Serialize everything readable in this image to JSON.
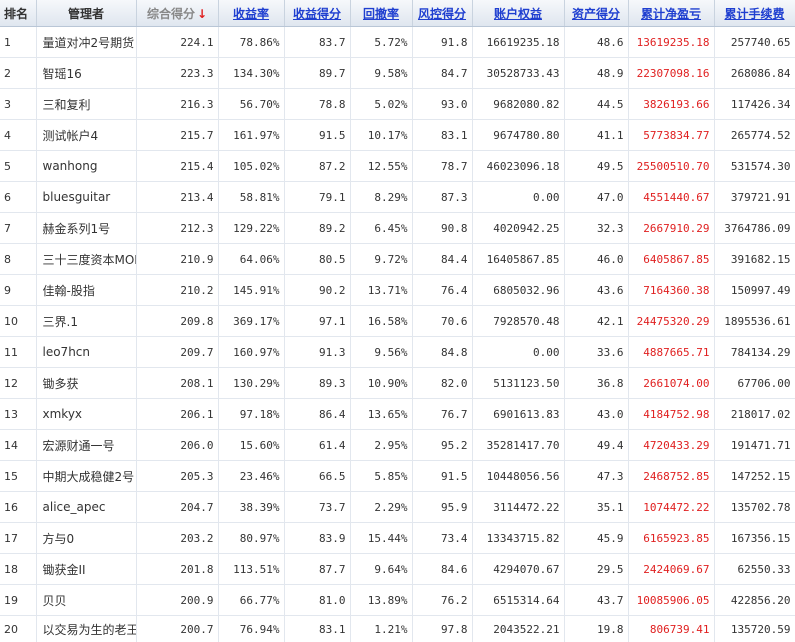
{
  "colors": {
    "link": "#1f3fd0",
    "loss_profit": "#e02020",
    "sorted_header": "#888888"
  },
  "headers": {
    "rank": "排名",
    "manager": "管理者",
    "score": "综合得分",
    "return_rate": "收益率",
    "return_score": "收益得分",
    "drawdown": "回撤率",
    "risk_score": "风控得分",
    "equity": "账户权益",
    "asset_score": "资产得分",
    "cum_profit": "累计净盈亏",
    "cum_fee": "累计手续费"
  },
  "sort_icon": "down-arrow-icon",
  "rows": [
    {
      "rank": "1",
      "name": "量道对冲2号期货",
      "score": "224.1",
      "ret": "78.86%",
      "ret_score": "83.7",
      "dd": "5.72%",
      "risk": "91.8",
      "equity": "16619235.18",
      "asset": "48.6",
      "profit": "13619235.18",
      "fee": "257740.65"
    },
    {
      "rank": "2",
      "name": "智瑶16",
      "score": "223.3",
      "ret": "134.30%",
      "ret_score": "89.7",
      "dd": "9.58%",
      "risk": "84.7",
      "equity": "30528733.43",
      "asset": "48.9",
      "profit": "22307098.16",
      "fee": "268086.84"
    },
    {
      "rank": "3",
      "name": "三和复利",
      "score": "216.3",
      "ret": "56.70%",
      "ret_score": "78.8",
      "dd": "5.02%",
      "risk": "93.0",
      "equity": "9682080.82",
      "asset": "44.5",
      "profit": "3826193.66",
      "fee": "117426.34"
    },
    {
      "rank": "4",
      "name": "测试帐户4",
      "score": "215.7",
      "ret": "161.97%",
      "ret_score": "91.5",
      "dd": "10.17%",
      "risk": "83.1",
      "equity": "9674780.80",
      "asset": "41.1",
      "profit": "5773834.77",
      "fee": "265774.52"
    },
    {
      "rank": "5",
      "name": "wanhong",
      "score": "215.4",
      "ret": "105.02%",
      "ret_score": "87.2",
      "dd": "12.55%",
      "risk": "78.7",
      "equity": "46023096.18",
      "asset": "49.5",
      "profit": "25500510.70",
      "fee": "531574.30"
    },
    {
      "rank": "6",
      "name": "bluesguitar",
      "score": "213.4",
      "ret": "58.81%",
      "ret_score": "79.1",
      "dd": "8.29%",
      "risk": "87.3",
      "equity": "0.00",
      "asset": "47.0",
      "profit": "4551440.67",
      "fee": "379721.91"
    },
    {
      "rank": "7",
      "name": "赫金系列1号",
      "score": "212.3",
      "ret": "129.22%",
      "ret_score": "89.2",
      "dd": "6.45%",
      "risk": "90.8",
      "equity": "4020942.25",
      "asset": "32.3",
      "profit": "2667910.29",
      "fee": "3764786.09"
    },
    {
      "rank": "8",
      "name": "三十三度资本MOM",
      "score": "210.9",
      "ret": "64.06%",
      "ret_score": "80.5",
      "dd": "9.72%",
      "risk": "84.4",
      "equity": "16405867.85",
      "asset": "46.0",
      "profit": "6405867.85",
      "fee": "391682.15"
    },
    {
      "rank": "9",
      "name": "佳翰-股指",
      "score": "210.2",
      "ret": "145.91%",
      "ret_score": "90.2",
      "dd": "13.71%",
      "risk": "76.4",
      "equity": "6805032.96",
      "asset": "43.6",
      "profit": "7164360.38",
      "fee": "150997.49"
    },
    {
      "rank": "10",
      "name": "三界.1",
      "score": "209.8",
      "ret": "369.17%",
      "ret_score": "97.1",
      "dd": "16.58%",
      "risk": "70.6",
      "equity": "7928570.48",
      "asset": "42.1",
      "profit": "24475320.29",
      "fee": "1895536.61"
    },
    {
      "rank": "11",
      "name": "leo7hcn",
      "score": "209.7",
      "ret": "160.97%",
      "ret_score": "91.3",
      "dd": "9.56%",
      "risk": "84.8",
      "equity": "0.00",
      "asset": "33.6",
      "profit": "4887665.71",
      "fee": "784134.29"
    },
    {
      "rank": "12",
      "name": "锄多获",
      "score": "208.1",
      "ret": "130.29%",
      "ret_score": "89.3",
      "dd": "10.90%",
      "risk": "82.0",
      "equity": "5131123.50",
      "asset": "36.8",
      "profit": "2661074.00",
      "fee": "67706.00"
    },
    {
      "rank": "13",
      "name": "xmkyx",
      "score": "206.1",
      "ret": "97.18%",
      "ret_score": "86.4",
      "dd": "13.65%",
      "risk": "76.7",
      "equity": "6901613.83",
      "asset": "43.0",
      "profit": "4184752.98",
      "fee": "218017.02"
    },
    {
      "rank": "14",
      "name": "宏源财通一号",
      "score": "206.0",
      "ret": "15.60%",
      "ret_score": "61.4",
      "dd": "2.95%",
      "risk": "95.2",
      "equity": "35281417.70",
      "asset": "49.4",
      "profit": "4720433.29",
      "fee": "191471.71"
    },
    {
      "rank": "15",
      "name": "中期大成稳健2号",
      "score": "205.3",
      "ret": "23.46%",
      "ret_score": "66.5",
      "dd": "5.85%",
      "risk": "91.5",
      "equity": "10448056.56",
      "asset": "47.3",
      "profit": "2468752.85",
      "fee": "147252.15"
    },
    {
      "rank": "16",
      "name": "alice_apec",
      "score": "204.7",
      "ret": "38.39%",
      "ret_score": "73.7",
      "dd": "2.29%",
      "risk": "95.9",
      "equity": "3114472.22",
      "asset": "35.1",
      "profit": "1074472.22",
      "fee": "135702.78"
    },
    {
      "rank": "17",
      "name": "方与0",
      "score": "203.2",
      "ret": "80.97%",
      "ret_score": "83.9",
      "dd": "15.44%",
      "risk": "73.4",
      "equity": "13343715.82",
      "asset": "45.9",
      "profit": "6165923.85",
      "fee": "167356.15"
    },
    {
      "rank": "18",
      "name": "锄获金II",
      "score": "201.8",
      "ret": "113.51%",
      "ret_score": "87.7",
      "dd": "9.64%",
      "risk": "84.6",
      "equity": "4294070.67",
      "asset": "29.5",
      "profit": "2424069.67",
      "fee": "62550.33"
    },
    {
      "rank": "19",
      "name": "贝贝",
      "score": "200.9",
      "ret": "66.77%",
      "ret_score": "81.0",
      "dd": "13.89%",
      "risk": "76.2",
      "equity": "6515314.64",
      "asset": "43.7",
      "profit": "10085906.05",
      "fee": "422856.20"
    },
    {
      "rank": "20",
      "name": "以交易为生的老王",
      "score": "200.7",
      "ret": "76.94%",
      "ret_score": "83.1",
      "dd": "1.21%",
      "risk": "97.8",
      "equity": "2043522.21",
      "asset": "19.8",
      "profit": "806739.41",
      "fee": "135720.59"
    }
  ]
}
